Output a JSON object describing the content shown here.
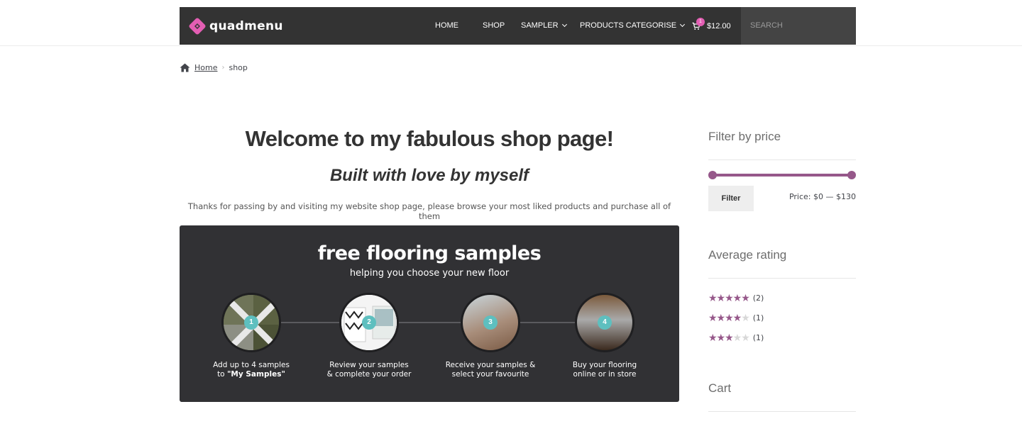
{
  "header": {
    "logo_text": "quadmenu",
    "nav": [
      {
        "label": "HOME"
      },
      {
        "label": "SHOP"
      },
      {
        "label": "SAMPLER"
      },
      {
        "label": "PRODUCTS CATEGORISE"
      }
    ],
    "cart": {
      "count": "1",
      "total": "$12.00"
    },
    "search_placeholder": "SEARCH"
  },
  "breadcrumb": {
    "home": "Home",
    "current": "shop"
  },
  "main": {
    "title": "Welcome to my fabulous shop page!",
    "subtitle": "Built with love by myself",
    "intro": "Thanks for passing by and visiting my website shop page, please browse your most liked products and purchase all of them"
  },
  "banner": {
    "title": "free flooring samples",
    "subtitle": "helping you choose your new floor",
    "steps": [
      {
        "num": "1",
        "line1": "Add up to 4 samples",
        "line2_pre": "to ",
        "line2_bold": "\"My Samples\""
      },
      {
        "num": "2",
        "line1": "Review your samples",
        "line2": "& complete your order"
      },
      {
        "num": "3",
        "line1": "Receive your samples &",
        "line2": "select your favourite"
      },
      {
        "num": "4",
        "line1": "Buy your flooring",
        "line2": "online or in store"
      }
    ]
  },
  "sidebar": {
    "filter_title": "Filter by price",
    "filter_button": "Filter",
    "price_range": "Price: $0 — $130",
    "rating_title": "Average rating",
    "ratings": [
      {
        "stars": 5,
        "count": "(2)"
      },
      {
        "stars": 4,
        "count": "(1)"
      },
      {
        "stars": 3,
        "count": "(1)"
      }
    ],
    "cart_title": "Cart"
  },
  "colors": {
    "accent": "#96588a",
    "nav_bg": "#333333",
    "banner_bg": "#313134",
    "step_badge": "#5ebfbf",
    "logo_pink": "#e35eb3"
  }
}
